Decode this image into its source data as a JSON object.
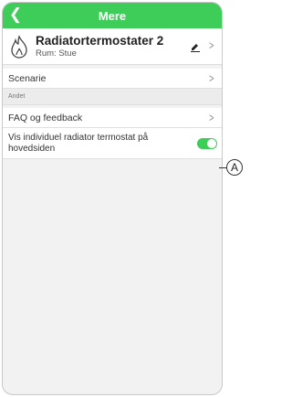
{
  "header": {
    "title": "Mere",
    "back_icon": "chevron-left-icon"
  },
  "device": {
    "name": "Radiatortermostater 2",
    "room": "Rum: Stue",
    "icon": "flame-icon",
    "edit_icon": "pencil-icon"
  },
  "menu": {
    "scenarie_label": "Scenarie",
    "section_andet": "Andet",
    "faq_label": "FAQ og feedback",
    "toggle_label": "Vis individuel radiator termostat på hovedsiden",
    "toggle_on": true
  },
  "callout": {
    "label": "A"
  },
  "colors": {
    "accent": "#3dcd58"
  }
}
